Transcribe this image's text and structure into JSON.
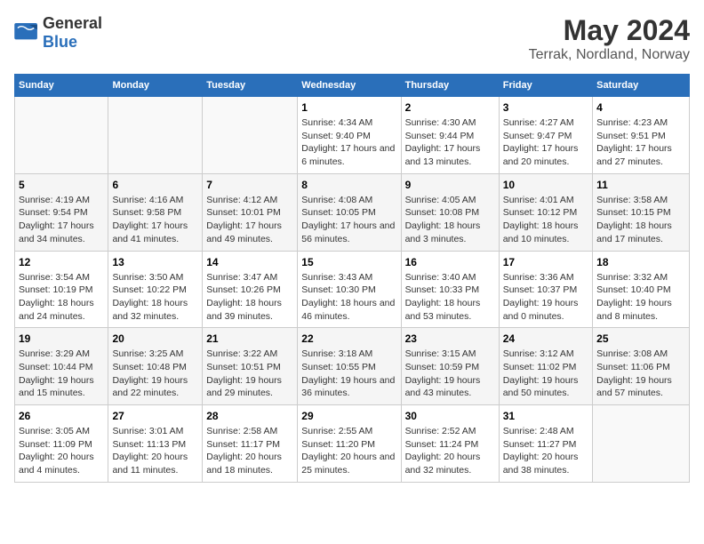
{
  "header": {
    "logo_general": "General",
    "logo_blue": "Blue",
    "title": "May 2024",
    "subtitle": "Terrak, Nordland, Norway"
  },
  "weekdays": [
    "Sunday",
    "Monday",
    "Tuesday",
    "Wednesday",
    "Thursday",
    "Friday",
    "Saturday"
  ],
  "weeks": [
    [
      {
        "day": "",
        "sunrise": "",
        "sunset": "",
        "daylight": ""
      },
      {
        "day": "",
        "sunrise": "",
        "sunset": "",
        "daylight": ""
      },
      {
        "day": "",
        "sunrise": "",
        "sunset": "",
        "daylight": ""
      },
      {
        "day": "1",
        "sunrise": "Sunrise: 4:34 AM",
        "sunset": "Sunset: 9:40 PM",
        "daylight": "Daylight: 17 hours and 6 minutes."
      },
      {
        "day": "2",
        "sunrise": "Sunrise: 4:30 AM",
        "sunset": "Sunset: 9:44 PM",
        "daylight": "Daylight: 17 hours and 13 minutes."
      },
      {
        "day": "3",
        "sunrise": "Sunrise: 4:27 AM",
        "sunset": "Sunset: 9:47 PM",
        "daylight": "Daylight: 17 hours and 20 minutes."
      },
      {
        "day": "4",
        "sunrise": "Sunrise: 4:23 AM",
        "sunset": "Sunset: 9:51 PM",
        "daylight": "Daylight: 17 hours and 27 minutes."
      }
    ],
    [
      {
        "day": "5",
        "sunrise": "Sunrise: 4:19 AM",
        "sunset": "Sunset: 9:54 PM",
        "daylight": "Daylight: 17 hours and 34 minutes."
      },
      {
        "day": "6",
        "sunrise": "Sunrise: 4:16 AM",
        "sunset": "Sunset: 9:58 PM",
        "daylight": "Daylight: 17 hours and 41 minutes."
      },
      {
        "day": "7",
        "sunrise": "Sunrise: 4:12 AM",
        "sunset": "Sunset: 10:01 PM",
        "daylight": "Daylight: 17 hours and 49 minutes."
      },
      {
        "day": "8",
        "sunrise": "Sunrise: 4:08 AM",
        "sunset": "Sunset: 10:05 PM",
        "daylight": "Daylight: 17 hours and 56 minutes."
      },
      {
        "day": "9",
        "sunrise": "Sunrise: 4:05 AM",
        "sunset": "Sunset: 10:08 PM",
        "daylight": "Daylight: 18 hours and 3 minutes."
      },
      {
        "day": "10",
        "sunrise": "Sunrise: 4:01 AM",
        "sunset": "Sunset: 10:12 PM",
        "daylight": "Daylight: 18 hours and 10 minutes."
      },
      {
        "day": "11",
        "sunrise": "Sunrise: 3:58 AM",
        "sunset": "Sunset: 10:15 PM",
        "daylight": "Daylight: 18 hours and 17 minutes."
      }
    ],
    [
      {
        "day": "12",
        "sunrise": "Sunrise: 3:54 AM",
        "sunset": "Sunset: 10:19 PM",
        "daylight": "Daylight: 18 hours and 24 minutes."
      },
      {
        "day": "13",
        "sunrise": "Sunrise: 3:50 AM",
        "sunset": "Sunset: 10:22 PM",
        "daylight": "Daylight: 18 hours and 32 minutes."
      },
      {
        "day": "14",
        "sunrise": "Sunrise: 3:47 AM",
        "sunset": "Sunset: 10:26 PM",
        "daylight": "Daylight: 18 hours and 39 minutes."
      },
      {
        "day": "15",
        "sunrise": "Sunrise: 3:43 AM",
        "sunset": "Sunset: 10:30 PM",
        "daylight": "Daylight: 18 hours and 46 minutes."
      },
      {
        "day": "16",
        "sunrise": "Sunrise: 3:40 AM",
        "sunset": "Sunset: 10:33 PM",
        "daylight": "Daylight: 18 hours and 53 minutes."
      },
      {
        "day": "17",
        "sunrise": "Sunrise: 3:36 AM",
        "sunset": "Sunset: 10:37 PM",
        "daylight": "Daylight: 19 hours and 0 minutes."
      },
      {
        "day": "18",
        "sunrise": "Sunrise: 3:32 AM",
        "sunset": "Sunset: 10:40 PM",
        "daylight": "Daylight: 19 hours and 8 minutes."
      }
    ],
    [
      {
        "day": "19",
        "sunrise": "Sunrise: 3:29 AM",
        "sunset": "Sunset: 10:44 PM",
        "daylight": "Daylight: 19 hours and 15 minutes."
      },
      {
        "day": "20",
        "sunrise": "Sunrise: 3:25 AM",
        "sunset": "Sunset: 10:48 PM",
        "daylight": "Daylight: 19 hours and 22 minutes."
      },
      {
        "day": "21",
        "sunrise": "Sunrise: 3:22 AM",
        "sunset": "Sunset: 10:51 PM",
        "daylight": "Daylight: 19 hours and 29 minutes."
      },
      {
        "day": "22",
        "sunrise": "Sunrise: 3:18 AM",
        "sunset": "Sunset: 10:55 PM",
        "daylight": "Daylight: 19 hours and 36 minutes."
      },
      {
        "day": "23",
        "sunrise": "Sunrise: 3:15 AM",
        "sunset": "Sunset: 10:59 PM",
        "daylight": "Daylight: 19 hours and 43 minutes."
      },
      {
        "day": "24",
        "sunrise": "Sunrise: 3:12 AM",
        "sunset": "Sunset: 11:02 PM",
        "daylight": "Daylight: 19 hours and 50 minutes."
      },
      {
        "day": "25",
        "sunrise": "Sunrise: 3:08 AM",
        "sunset": "Sunset: 11:06 PM",
        "daylight": "Daylight: 19 hours and 57 minutes."
      }
    ],
    [
      {
        "day": "26",
        "sunrise": "Sunrise: 3:05 AM",
        "sunset": "Sunset: 11:09 PM",
        "daylight": "Daylight: 20 hours and 4 minutes."
      },
      {
        "day": "27",
        "sunrise": "Sunrise: 3:01 AM",
        "sunset": "Sunset: 11:13 PM",
        "daylight": "Daylight: 20 hours and 11 minutes."
      },
      {
        "day": "28",
        "sunrise": "Sunrise: 2:58 AM",
        "sunset": "Sunset: 11:17 PM",
        "daylight": "Daylight: 20 hours and 18 minutes."
      },
      {
        "day": "29",
        "sunrise": "Sunrise: 2:55 AM",
        "sunset": "Sunset: 11:20 PM",
        "daylight": "Daylight: 20 hours and 25 minutes."
      },
      {
        "day": "30",
        "sunrise": "Sunrise: 2:52 AM",
        "sunset": "Sunset: 11:24 PM",
        "daylight": "Daylight: 20 hours and 32 minutes."
      },
      {
        "day": "31",
        "sunrise": "Sunrise: 2:48 AM",
        "sunset": "Sunset: 11:27 PM",
        "daylight": "Daylight: 20 hours and 38 minutes."
      },
      {
        "day": "",
        "sunrise": "",
        "sunset": "",
        "daylight": ""
      }
    ]
  ]
}
